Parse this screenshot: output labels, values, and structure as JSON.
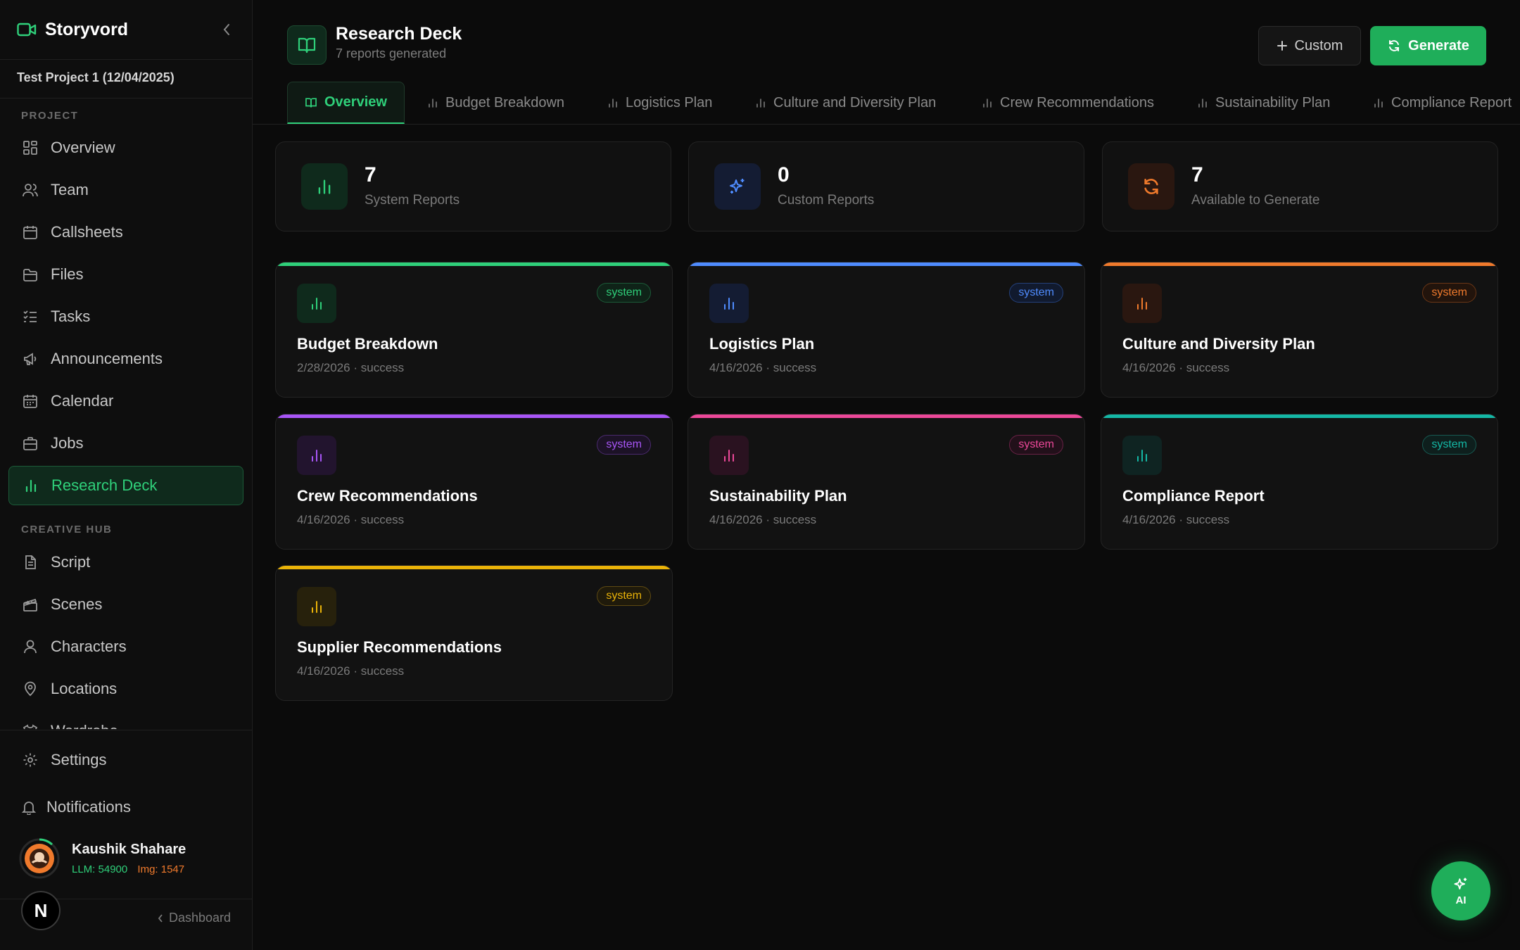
{
  "app": {
    "name": "Storyvord",
    "project": "Test Project 1 (12/04/2025)"
  },
  "sidebar": {
    "project_label": "PROJECT",
    "creative_label": "CREATIVE HUB",
    "project_items": [
      {
        "label": "Overview",
        "icon": "grid-icon"
      },
      {
        "label": "Team",
        "icon": "users-icon"
      },
      {
        "label": "Callsheets",
        "icon": "calendar-icon"
      },
      {
        "label": "Files",
        "icon": "folder-icon"
      },
      {
        "label": "Tasks",
        "icon": "list-check-icon"
      },
      {
        "label": "Announcements",
        "icon": "megaphone-icon"
      },
      {
        "label": "Calendar",
        "icon": "calendar-icon"
      },
      {
        "label": "Jobs",
        "icon": "briefcase-icon"
      },
      {
        "label": "Research Deck",
        "icon": "bar-chart-icon",
        "active": true
      }
    ],
    "creative_items": [
      {
        "label": "Script",
        "icon": "file-text-icon"
      },
      {
        "label": "Scenes",
        "icon": "clapperboard-icon"
      },
      {
        "label": "Characters",
        "icon": "user-icon"
      },
      {
        "label": "Locations",
        "icon": "map-pin-icon"
      },
      {
        "label": "Wardrobe",
        "icon": "shirt-icon"
      }
    ],
    "settings": "Settings",
    "notifications": "Notifications",
    "user": {
      "name": "Kaushik Shahare",
      "llm": "LLM: 54900",
      "img": "Img: 1547"
    },
    "dashboard_link": "Dashboard",
    "n_badge": "N"
  },
  "header": {
    "title": "Research Deck",
    "subtitle": "7 reports generated",
    "custom_button": "Custom",
    "generate_button": "Generate"
  },
  "tabs": [
    {
      "label": "Overview",
      "active": true
    },
    {
      "label": "Budget Breakdown"
    },
    {
      "label": "Logistics Plan"
    },
    {
      "label": "Culture and Diversity Plan"
    },
    {
      "label": "Crew Recommendations"
    },
    {
      "label": "Sustainability Plan"
    },
    {
      "label": "Compliance Report"
    }
  ],
  "stats": [
    {
      "value": "7",
      "label": "System Reports",
      "color": "#2fd07a"
    },
    {
      "value": "0",
      "label": "Custom Reports",
      "color": "#4f8cff"
    },
    {
      "value": "7",
      "label": "Available to Generate",
      "color": "#f07a2c"
    }
  ],
  "reports": [
    {
      "title": "Budget Breakdown",
      "meta": "2/28/2026 · success",
      "badge": "system",
      "color": "#2fd07a"
    },
    {
      "title": "Logistics Plan",
      "meta": "4/16/2026 · success",
      "badge": "system",
      "color": "#4f8cff"
    },
    {
      "title": "Culture and Diversity Plan",
      "meta": "4/16/2026 · success",
      "badge": "system",
      "color": "#f07a2c"
    },
    {
      "title": "Crew Recommendations",
      "meta": "4/16/2026 · success",
      "badge": "system",
      "color": "#a855f7"
    },
    {
      "title": "Sustainability Plan",
      "meta": "4/16/2026 · success",
      "badge": "system",
      "color": "#ec4899"
    },
    {
      "title": "Compliance Report",
      "meta": "4/16/2026 · success",
      "badge": "system",
      "color": "#14b8a6"
    },
    {
      "title": "Supplier Recommendations",
      "meta": "4/16/2026 · success",
      "badge": "system",
      "color": "#eab308"
    }
  ],
  "ai_button": "AI"
}
